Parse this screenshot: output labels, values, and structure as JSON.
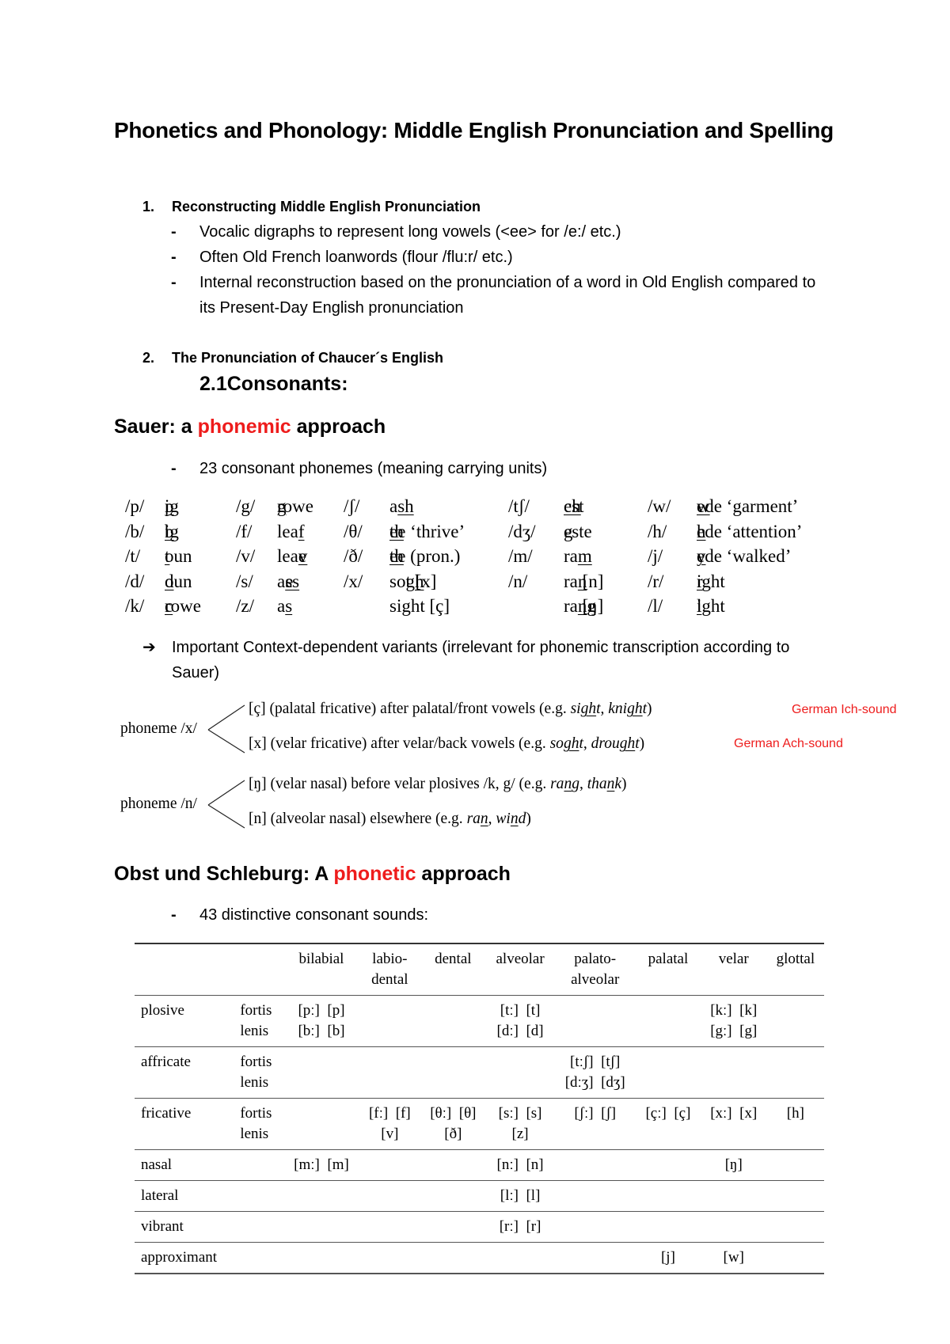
{
  "title": "Phonetics and Phonology: Middle English Pronunciation and Spelling",
  "section1": {
    "number": "1.",
    "heading": "Reconstructing Middle English Pronunciation",
    "bullets": [
      "Vocalic digraphs to represent long vowels (<ee> for /e:/ etc.)",
      "Often Old French loanwords (flour /flu:r/ etc.)",
      "Internal reconstruction based on the pronunciation of a word in Old English compared to its Present-Day English pronunciation"
    ],
    "bullet_marker": "-"
  },
  "section2": {
    "number": "2.",
    "heading": "The Pronunciation of Chaucer´s English",
    "subheading": "2.1Consonants:"
  },
  "sauer": {
    "heading_pre": "Sauer: a ",
    "heading_red": "phonemic",
    "heading_post": " approach",
    "bullet": "23 consonant phonemes (meaning carrying units)",
    "phonemes": [
      [
        {
          "p": "/p/",
          "pre": "",
          "u": "p",
          "post": "ig"
        },
        {
          "p": "/g/",
          "pre": "",
          "u": "g",
          "post": "rowe"
        },
        {
          "p": "/ʃ/",
          "pre": "a",
          "u": "sh",
          "post": ""
        },
        {
          "p": "/tʃ/",
          "pre": "",
          "u": "ch",
          "post": "est"
        },
        {
          "p": "/w/",
          "pre": "",
          "u": "w",
          "post": "ede ‘garment’"
        }
      ],
      [
        {
          "p": "/b/",
          "pre": "",
          "u": "b",
          "post": "ig"
        },
        {
          "p": "/f/",
          "pre": "lea",
          "u": "f",
          "post": ""
        },
        {
          "p": "/θ/",
          "pre": "",
          "u": "th",
          "post": "ee ‘thrive’"
        },
        {
          "p": "/dʒ/",
          "pre": "",
          "u": "g",
          "post": "este"
        },
        {
          "p": "/h/",
          "pre": "",
          "u": "h",
          "post": "ede ‘attention’"
        }
      ],
      [
        {
          "p": "/t/",
          "pre": "",
          "u": "t",
          "post": "oun"
        },
        {
          "p": "/v/",
          "pre": "lea",
          "u": "v",
          "post": "e"
        },
        {
          "p": "/ð/",
          "pre": "",
          "u": "th",
          "post": "ee (pron.)"
        },
        {
          "p": "/m/",
          "pre": "ra",
          "u": "m",
          "post": ""
        },
        {
          "p": "/j/",
          "pre": "",
          "u": "y",
          "post": "ede ‘walked’"
        }
      ],
      [
        {
          "p": "/d/",
          "pre": "",
          "u": "d",
          "post": "oun"
        },
        {
          "p": "/s/",
          "pre": "a",
          "u": "ss",
          "post": "e"
        },
        {
          "p": "/x/",
          "pre": "so",
          "u": "gh",
          "post": "t [x]"
        },
        {
          "p": "/n/",
          "pre": "ra",
          "u": "n",
          "post": " [n]"
        },
        {
          "p": "/r/",
          "pre": "",
          "u": "r",
          "post": "ight"
        }
      ],
      [
        {
          "p": "/k/",
          "pre": "",
          "u": "c",
          "post": "rowe"
        },
        {
          "p": "/z/",
          "pre": "a",
          "u": "s",
          "post": ""
        },
        {
          "p": "",
          "pre": "sight [ç]",
          "u": "",
          "post": ""
        },
        {
          "p": "",
          "pre": "ra",
          "u": "ng",
          "post": " [ŋ]"
        },
        {
          "p": "/l/",
          "pre": "",
          "u": "l",
          "post": "ight"
        }
      ]
    ],
    "arrow_note": "Important Context-dependent variants (irrelevant for phonemic transcription according to Sauer)",
    "arrow_icon": "➔",
    "allophones": [
      {
        "phoneme": "phoneme /x/",
        "variants": [
          {
            "text": "[ç] (palatal fricative) after palatal/front vowels (e.g. ",
            "ex1_pre": "si",
            "ex1_u": "gh",
            "ex1_post": "t",
            "ex2_pre": "kni",
            "ex2_u": "gh",
            "ex2_post": "t",
            "close": ")",
            "note": "German Ich-sound"
          },
          {
            "text": "[x] (velar fricative) after velar/back vowels (e.g. ",
            "ex1_pre": "so",
            "ex1_u": "gh",
            "ex1_post": "t",
            "ex2_pre": "drou",
            "ex2_u": "gh",
            "ex2_post": "t",
            "close": ")",
            "note": "German Ach-sound"
          }
        ]
      },
      {
        "phoneme": "phoneme /n/",
        "variants": [
          {
            "text": "[ŋ] (velar nasal) before velar plosives /k, g/ (e.g. ",
            "ex1_pre": "ra",
            "ex1_u": "n",
            "ex1_post": "g",
            "ex2_pre": "tha",
            "ex2_u": "n",
            "ex2_post": "k",
            "close": ")",
            "note": ""
          },
          {
            "text": "[n] (alveolar nasal) elsewhere (e.g. ",
            "ex1_pre": "ra",
            "ex1_u": "n",
            "ex1_post": "",
            "ex2_pre": "wi",
            "ex2_u": "n",
            "ex2_post": "d",
            "close": ")",
            "note": ""
          }
        ]
      }
    ]
  },
  "obst": {
    "heading_pre": "Obst und Schleburg: A ",
    "heading_red": "phonetic",
    "heading_post": " approach",
    "bullet": "43 distinctive consonant sounds:",
    "table": {
      "columns": [
        "",
        "",
        "bilabial",
        "labio-\ndental",
        "dental",
        "alveolar",
        "palato-\nalveolar",
        "palatal",
        "velar",
        "glottal"
      ],
      "rows": [
        {
          "manner": "plosive",
          "sub": "fortis\nlenis",
          "cells": [
            "[pː]  [p]\n[bː]  [b]",
            "",
            "",
            "[tː]  [t]\n[dː]  [d]",
            "",
            "",
            "[kː]  [k]\n[gː]  [g]",
            ""
          ]
        },
        {
          "manner": "affricate",
          "sub": "fortis\nlenis",
          "cells": [
            "",
            "",
            "",
            "",
            "[tːʃ]  [tʃ]\n[dːʒ]  [dʒ]",
            "",
            "",
            ""
          ]
        },
        {
          "manner": "fricative",
          "sub": "fortis\nlenis",
          "cells": [
            "",
            "[fː]  [f]\n[v]",
            "[θː]  [θ]\n[ð]",
            "[sː]  [s]\n[z]",
            "[ʃː]  [ʃ]",
            "[çː]  [ç]",
            "[xː]  [x]",
            "[h]"
          ]
        },
        {
          "manner": "nasal",
          "sub": "",
          "cells": [
            "[mː]  [m]",
            "",
            "",
            "[nː]  [n]",
            "",
            "",
            "[ŋ]",
            ""
          ]
        },
        {
          "manner": "lateral",
          "sub": "",
          "cells": [
            "",
            "",
            "",
            "[lː]  [l]",
            "",
            "",
            "",
            ""
          ]
        },
        {
          "manner": "vibrant",
          "sub": "",
          "cells": [
            "",
            "",
            "",
            "[rː]  [r]",
            "",
            "",
            "",
            ""
          ]
        },
        {
          "manner": "approximant",
          "sub": "",
          "cells": [
            "",
            "",
            "",
            "",
            "",
            "[j]",
            "[w]",
            ""
          ]
        }
      ]
    }
  },
  "colors": {
    "accent_red": "#ee1c1c",
    "text": "#000000",
    "rule": "#444444"
  }
}
